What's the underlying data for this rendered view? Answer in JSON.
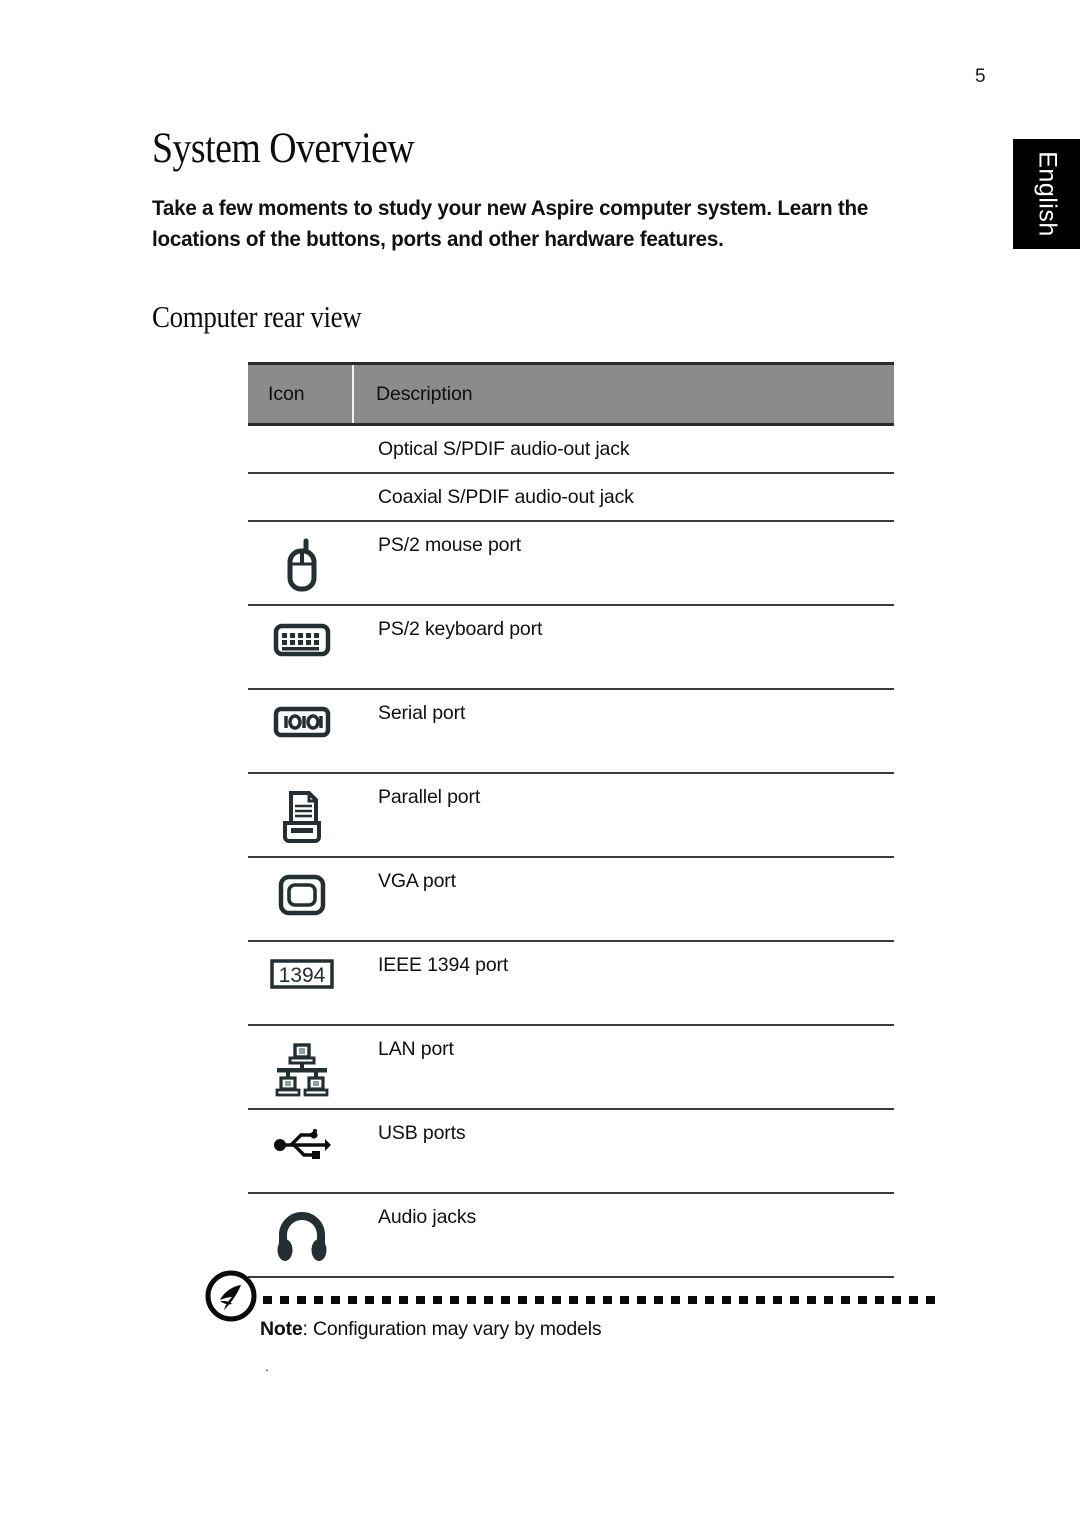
{
  "page": {
    "number": "5",
    "language_tab": "English"
  },
  "heading": {
    "title": "System Overview",
    "intro": "Take a few moments to study your new Aspire computer system. Learn the locations of the buttons, ports and other hardware features.",
    "section": "Computer rear view"
  },
  "table": {
    "columns": [
      "Icon",
      "Description"
    ],
    "rows": [
      {
        "icon": "none",
        "description": "Optical S/PDIF audio-out jack"
      },
      {
        "icon": "none",
        "description": "Coaxial S/PDIF audio-out jack"
      },
      {
        "icon": "mouse-icon",
        "description": "PS/2 mouse port"
      },
      {
        "icon": "keyboard-icon",
        "description": "PS/2 keyboard  port"
      },
      {
        "icon": "serial-port-icon",
        "description": "Serial port"
      },
      {
        "icon": "printer-icon",
        "description": "Parallel port"
      },
      {
        "icon": "monitor-icon",
        "description": "VGA port"
      },
      {
        "icon": "ieee1394-icon",
        "description": "IEEE 1394 port",
        "icon_label": "1394"
      },
      {
        "icon": "lan-icon",
        "description": "LAN port"
      },
      {
        "icon": "usb-icon",
        "description": "USB ports"
      },
      {
        "icon": "headphones-icon",
        "description": "Audio jacks"
      }
    ]
  },
  "note": {
    "logo": "acer-logo-icon",
    "label": "Note",
    "separator": ":",
    "text": " Configuration may vary by models",
    "trailing_mark": "."
  },
  "colors": {
    "header_gray": "#8b8b8b",
    "rule_dark": "#3b3b3b",
    "icon_dark": "#232f33",
    "tab_black": "#000000",
    "tab_text": "#ffffff"
  }
}
